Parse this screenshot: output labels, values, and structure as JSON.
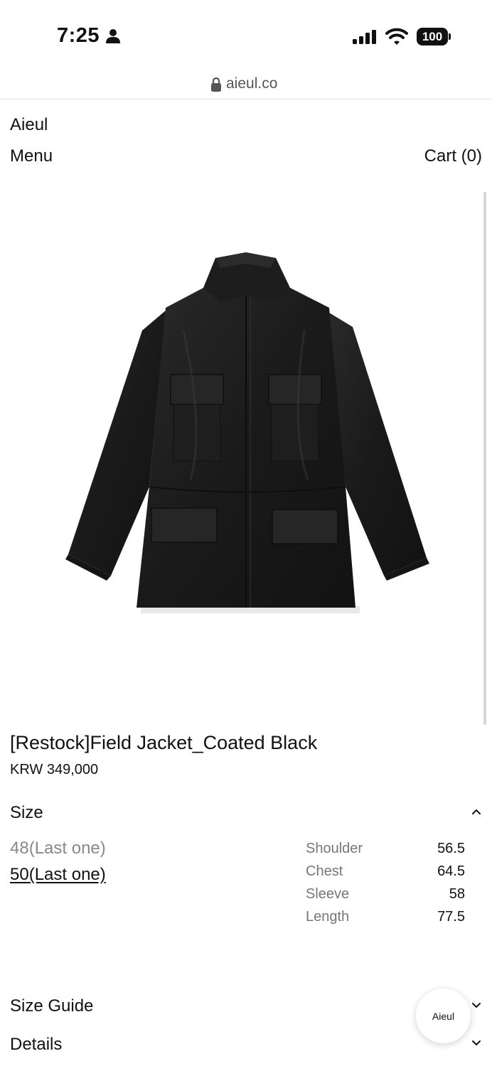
{
  "status_bar": {
    "time": "7:25",
    "battery": "100",
    "icons": [
      "person-icon",
      "signal-icon",
      "wifi-icon",
      "battery-icon"
    ]
  },
  "browser": {
    "url": "aieul.co",
    "icon": "lock-icon"
  },
  "header": {
    "brand": "Aieul",
    "menu_label": "Menu",
    "cart_label": "Cart (0)"
  },
  "product": {
    "image_alt": "Field Jacket Coated Black",
    "title": "[Restock]Field Jacket_Coated Black",
    "price": "KRW 349,000"
  },
  "size_section": {
    "heading": "Size",
    "options": [
      {
        "label": "48(Last one)",
        "selected": false
      },
      {
        "label": "50(Last one)",
        "selected": true
      }
    ],
    "measurements": [
      {
        "label": "Shoulder",
        "value": "56.5"
      },
      {
        "label": "Chest",
        "value": "64.5"
      },
      {
        "label": "Sleeve",
        "value": "58"
      },
      {
        "label": "Length",
        "value": "77.5"
      }
    ]
  },
  "accordions": {
    "size_guide": "Size Guide",
    "details": "Details"
  },
  "float_button": {
    "label": "Aieul"
  },
  "colors": {
    "text": "#111111",
    "muted": "#777777",
    "jacket": "#1c1c1c"
  }
}
